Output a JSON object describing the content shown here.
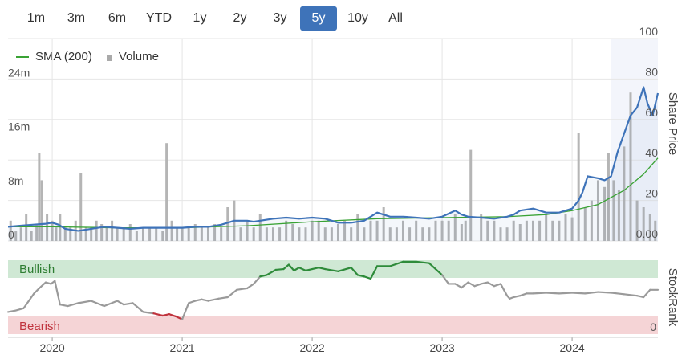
{
  "range_selector": {
    "buttons": [
      "1m",
      "3m",
      "6m",
      "YTD",
      "1y",
      "2y",
      "3y",
      "5y",
      "10y",
      "All"
    ],
    "active": "5y"
  },
  "colors": {
    "price": "#3e73b9",
    "sma": "#3aa335",
    "volume": "#b5b5b5",
    "bullish_band": "#cfe8d4",
    "bearish_band": "#f5d4d6",
    "rank_neutral": "#9a9a9a",
    "rank_bullish": "#2e8b3a",
    "rank_bearish": "#c0333d",
    "grid": "#e6e6e6"
  },
  "chart_data": [
    {
      "type": "line",
      "ylabel": "Share Price",
      "y_ticks": [
        "100",
        "80",
        "60",
        "40",
        "20",
        "0.00"
      ],
      "ylim": [
        0,
        100
      ],
      "volume_ticks": [
        "24m",
        "16m",
        "8m",
        "0"
      ],
      "volume_lim": [
        0,
        30
      ],
      "x_ticks": [
        "2020",
        "2021",
        "2022",
        "2023",
        "2024"
      ],
      "xlim": [
        2019.66,
        2024.66
      ],
      "grid": true,
      "legend": [
        "SMA (200)",
        "Volume"
      ],
      "series": [
        {
          "name": "",
          "x": [
            2019.66,
            2019.75,
            2019.85,
            2019.95,
            2020.0,
            2020.05,
            2020.1,
            2020.2,
            2020.3,
            2020.4,
            2020.5,
            2020.6,
            2020.7,
            2020.8,
            2020.9,
            2021.0,
            2021.1,
            2021.2,
            2021.3,
            2021.4,
            2021.5,
            2021.55,
            2021.6,
            2021.7,
            2021.8,
            2021.9,
            2022.0,
            2022.1,
            2022.2,
            2022.3,
            2022.4,
            2022.5,
            2022.6,
            2022.65,
            2022.7,
            2022.8,
            2022.9,
            2023.0,
            2023.1,
            2023.15,
            2023.2,
            2023.3,
            2023.4,
            2023.5,
            2023.55,
            2023.6,
            2023.7,
            2023.8,
            2023.9,
            2024.0,
            2024.05,
            2024.08,
            2024.12,
            2024.2,
            2024.25,
            2024.3,
            2024.35,
            2024.4,
            2024.45,
            2024.5,
            2024.55,
            2024.58,
            2024.62,
            2024.66
          ],
          "values": [
            7,
            7.5,
            8,
            8.5,
            9,
            8,
            6,
            5,
            6,
            7,
            6.5,
            6,
            6.5,
            6.5,
            6.5,
            6.5,
            7,
            7,
            8,
            10,
            10,
            9.5,
            10,
            11,
            11.5,
            11,
            11.5,
            11,
            9,
            9,
            10,
            14,
            12,
            12,
            12,
            11.5,
            11,
            12,
            15,
            13,
            12,
            11.5,
            11,
            12,
            13,
            15,
            16,
            14,
            14,
            16,
            20,
            24,
            32,
            31,
            30,
            32,
            44,
            53,
            62,
            66,
            76,
            68,
            62,
            73
          ]
        },
        {
          "name": "SMA (200)",
          "x": [
            2019.66,
            2020.0,
            2020.5,
            2021.0,
            2021.5,
            2022.0,
            2022.5,
            2023.0,
            2023.5,
            2023.8,
            2024.0,
            2024.2,
            2024.4,
            2024.55,
            2024.66
          ],
          "values": [
            7,
            7,
            6.5,
            6.5,
            7.5,
            9.5,
            11,
            11.5,
            12,
            13,
            15,
            18,
            25,
            33,
            41
          ]
        }
      ],
      "volume_x": [
        2019.68,
        2019.72,
        2019.76,
        2019.8,
        2019.84,
        2019.88,
        2019.9,
        2019.92,
        2019.96,
        2020.0,
        2020.03,
        2020.06,
        2020.1,
        2020.14,
        2020.18,
        2020.22,
        2020.26,
        2020.3,
        2020.34,
        2020.38,
        2020.42,
        2020.46,
        2020.5,
        2020.55,
        2020.6,
        2020.65,
        2020.7,
        2020.75,
        2020.8,
        2020.85,
        2020.88,
        2020.92,
        2020.96,
        2021.0,
        2021.05,
        2021.1,
        2021.15,
        2021.2,
        2021.25,
        2021.3,
        2021.35,
        2021.4,
        2021.45,
        2021.5,
        2021.55,
        2021.6,
        2021.65,
        2021.7,
        2021.75,
        2021.8,
        2021.85,
        2021.9,
        2021.95,
        2022.0,
        2022.05,
        2022.1,
        2022.15,
        2022.2,
        2022.25,
        2022.3,
        2022.35,
        2022.4,
        2022.45,
        2022.5,
        2022.55,
        2022.6,
        2022.65,
        2022.7,
        2022.75,
        2022.8,
        2022.85,
        2022.9,
        2022.95,
        2023.0,
        2023.05,
        2023.1,
        2023.15,
        2023.18,
        2023.22,
        2023.3,
        2023.35,
        2023.4,
        2023.45,
        2023.5,
        2023.55,
        2023.6,
        2023.65,
        2023.7,
        2023.75,
        2023.8,
        2023.85,
        2023.9,
        2023.95,
        2024.0,
        2024.05,
        2024.1,
        2024.15,
        2024.2,
        2024.25,
        2024.28,
        2024.32,
        2024.36,
        2024.4,
        2024.45,
        2024.5,
        2024.55,
        2024.6,
        2024.64
      ],
      "volume_values": [
        3,
        1.5,
        2,
        4,
        1.5,
        2.5,
        13,
        9,
        4,
        3,
        2,
        4,
        2,
        2,
        3,
        10,
        2,
        2,
        3,
        2.5,
        2,
        3,
        2,
        2,
        2.5,
        1.5,
        2,
        2,
        2,
        1.5,
        14.5,
        3,
        2,
        2,
        2,
        2.5,
        2,
        2,
        2.5,
        2,
        5,
        6,
        2,
        3,
        2,
        4,
        2,
        2,
        2,
        3,
        2.5,
        2,
        2,
        3,
        3,
        2,
        2,
        2.5,
        3,
        2,
        4,
        2,
        3,
        3,
        5,
        2,
        2,
        3,
        2,
        3,
        2,
        2,
        3,
        3,
        3,
        4,
        2.5,
        3,
        13.5,
        4,
        3,
        3,
        2,
        2,
        3,
        2.5,
        3,
        3,
        3,
        4,
        3,
        3,
        4,
        3.5,
        16,
        5,
        6,
        9,
        8,
        13,
        9,
        7.5,
        14,
        22,
        6,
        5,
        4,
        3
      ]
    },
    {
      "type": "line",
      "ylabel": "StockRank",
      "y_ticks": [
        "0"
      ],
      "ylim": [
        0,
        100
      ],
      "bands": [
        "Bullish",
        "Bearish"
      ],
      "x_ticks": [
        "2020",
        "2021",
        "2022",
        "2023",
        "2024"
      ],
      "xlim": [
        2019.66,
        2024.66
      ],
      "series": [
        {
          "name": "",
          "x": [
            2019.66,
            2019.72,
            2019.78,
            2019.82,
            2019.86,
            2019.9,
            2019.95,
            2019.99,
            2020.02,
            2020.06,
            2020.12,
            2020.2,
            2020.3,
            2020.4,
            2020.5,
            2020.55,
            2020.62,
            2020.7,
            2020.78,
            2020.85,
            2020.9,
            2020.95,
            2021.0,
            2021.05,
            2021.1,
            2021.15,
            2021.2,
            2021.28,
            2021.35,
            2021.42,
            2021.5,
            2021.55,
            2021.6,
            2021.65,
            2021.7,
            2021.72,
            2021.78,
            2021.82,
            2021.86,
            2021.9,
            2021.95,
            2022.0,
            2022.05,
            2022.1,
            2022.2,
            2022.3,
            2022.35,
            2022.4,
            2022.45,
            2022.5,
            2022.6,
            2022.7,
            2022.8,
            2022.9,
            2022.95,
            2023.0,
            2023.05,
            2023.1,
            2023.15,
            2023.2,
            2023.25,
            2023.3,
            2023.35,
            2023.4,
            2023.45,
            2023.5,
            2023.52,
            2023.55,
            2023.6,
            2023.65,
            2023.7,
            2023.8,
            2023.9,
            2024.0,
            2024.1,
            2024.2,
            2024.3,
            2024.4,
            2024.5,
            2024.55,
            2024.6,
            2024.66
          ],
          "values": [
            30,
            32,
            35,
            45,
            55,
            62,
            70,
            68,
            72,
            40,
            38,
            42,
            45,
            38,
            45,
            40,
            42,
            30,
            28,
            25,
            27,
            24,
            20,
            42,
            45,
            47,
            45,
            48,
            50,
            60,
            62,
            68,
            78,
            80,
            85,
            87,
            88,
            94,
            86,
            90,
            86,
            88,
            90,
            88,
            85,
            90,
            80,
            78,
            75,
            92,
            92,
            98,
            98,
            96,
            88,
            80,
            68,
            68,
            63,
            70,
            65,
            68,
            70,
            65,
            68,
            52,
            48,
            50,
            52,
            55,
            55,
            56,
            55,
            56,
            55,
            57,
            56,
            54,
            52,
            50,
            60,
            60
          ]
        }
      ]
    }
  ]
}
